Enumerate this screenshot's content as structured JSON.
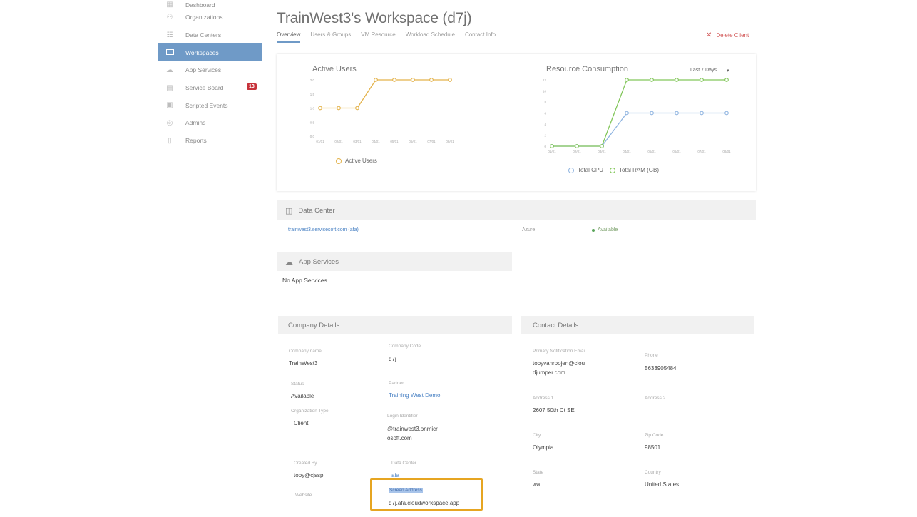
{
  "sidebar": {
    "items": [
      {
        "label": "Dashboard",
        "icon": "dashboard-icon"
      },
      {
        "label": "Organizations",
        "icon": "organizations-icon"
      },
      {
        "label": "Data Centers",
        "icon": "data-centers-icon"
      },
      {
        "label": "Workspaces",
        "icon": "monitor-icon",
        "active": true
      },
      {
        "label": "App Services",
        "icon": "cloud-icon"
      },
      {
        "label": "Service Board",
        "icon": "clipboard-icon",
        "badge": "13"
      },
      {
        "label": "Scripted Events",
        "icon": "script-icon"
      },
      {
        "label": "Admins",
        "icon": "user-icon"
      },
      {
        "label": "Reports",
        "icon": "report-icon"
      }
    ]
  },
  "header": {
    "title": "TrainWest3's Workspace (d7j)",
    "tabs": [
      "Overview",
      "Users & Groups",
      "VM Resource",
      "Workload Schedule",
      "Contact Info"
    ],
    "delete_label": "Delete Client"
  },
  "colors": {
    "accent": "#6f9ac7",
    "active_users": "#e3b24a",
    "total_cpu": "#8fb4e0",
    "total_ram": "#82c65a",
    "highlight": "#e6a521"
  },
  "chart_data": [
    {
      "type": "line",
      "title": "Active Users",
      "categories": [
        "01/01",
        "02/01",
        "03/01",
        "04/01",
        "05/01",
        "06/01",
        "07/01",
        "08/01"
      ],
      "yticks": [
        "2.0",
        "1.5",
        "1.0",
        "0.5",
        "0.0"
      ],
      "ylim": [
        0,
        2
      ],
      "series": [
        {
          "name": "Active Users",
          "values": [
            1,
            1,
            1,
            2,
            2,
            2,
            2,
            2
          ]
        }
      ]
    },
    {
      "type": "line",
      "title": "Resource Consumption",
      "range_label": "Last 7 Days",
      "categories": [
        "01/01",
        "02/01",
        "03/01",
        "04/01",
        "05/01",
        "06/01",
        "07/01",
        "08/01"
      ],
      "yticks": [
        "12",
        "10",
        "8",
        "6",
        "4",
        "2",
        "0"
      ],
      "ylim": [
        0,
        12
      ],
      "series": [
        {
          "name": "Total CPU",
          "values": [
            0,
            0,
            0,
            6,
            6,
            6,
            6,
            6
          ]
        },
        {
          "name": "Total RAM (GB)",
          "values": [
            0,
            0,
            0,
            12,
            12,
            12,
            12,
            12
          ]
        }
      ]
    }
  ],
  "data_center": {
    "heading": "Data Center",
    "link": "trainwest3.servicesoft.com (afa)",
    "provider": "Azure",
    "status": "Available"
  },
  "app_services": {
    "heading": "App Services",
    "empty_text": "No App Services."
  },
  "company": {
    "heading": "Company Details",
    "company_name_label": "Company name",
    "company_name": "TrainWest3",
    "company_code_label": "Company Code",
    "company_code": "d7j",
    "status_label": "Status",
    "status": "Available",
    "partner_label": "Partner",
    "partner": "Training West Demo",
    "org_type_label": "Organization Type",
    "org_type": "Client",
    "login_id_label": "Login Identifier",
    "login_id_1": "@trainwest3.onmicr",
    "login_id_2": "osoft.com",
    "created_by_label": "Created By",
    "created_by": "toby@cjssp",
    "data_center_label": "Data Center",
    "data_center": "afa",
    "website_label": "Website",
    "screen_address_label": "Screen Address",
    "screen_address": "d7j.afa.cloudworkspace.app"
  },
  "contact": {
    "heading": "Contact Details",
    "email_label": "Primary Notification Email",
    "email_1": "tobyvanroojen@clou",
    "email_2": "djumper.com",
    "phone_label": "Phone",
    "phone": "5633905484",
    "address1_label": "Address 1",
    "address1": "2607 50th Ct SE",
    "address2_label": "Address 2",
    "city_label": "City",
    "city": "Olympia",
    "zip_label": "Zip Code",
    "zip": "98501",
    "state_label": "State",
    "state": "wa",
    "country_label": "Country",
    "country": "United States"
  }
}
